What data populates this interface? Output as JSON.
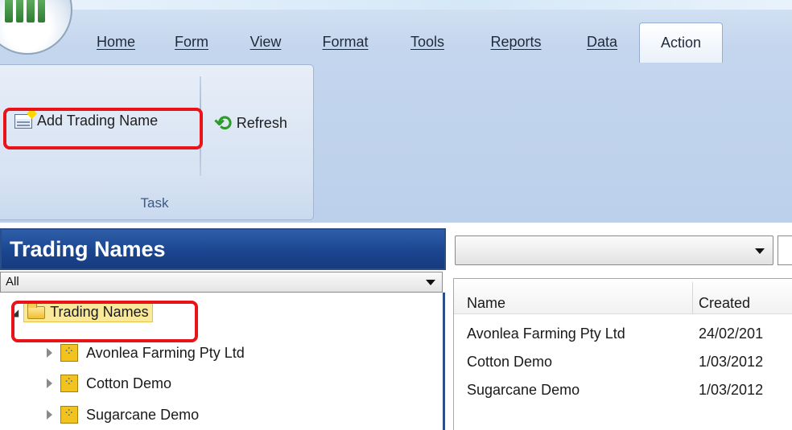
{
  "ribbon": {
    "tabs": [
      {
        "label": "Home",
        "active": false
      },
      {
        "label": "Form",
        "active": false
      },
      {
        "label": "View",
        "active": false
      },
      {
        "label": "Format",
        "active": false
      },
      {
        "label": "Tools",
        "active": false
      },
      {
        "label": "Reports",
        "active": false
      },
      {
        "label": "Data",
        "active": false
      },
      {
        "label": "Action",
        "active": true
      }
    ],
    "group_label": "Task",
    "add_trading_name_label": "Add Trading Name",
    "refresh_label": "Refresh",
    "highlight_color": "#e8141a"
  },
  "left_pane": {
    "title": "Trading Names",
    "filter_value": "All",
    "tree": {
      "root_label": "Trading Names",
      "items": [
        {
          "label": "Avonlea Farming Pty Ltd"
        },
        {
          "label": "Cotton Demo"
        },
        {
          "label": "Sugarcane Demo"
        }
      ]
    },
    "header_color": "#1b4590"
  },
  "right_pane": {
    "combo_value": "",
    "columns": {
      "name": "Name",
      "created": "Created"
    },
    "rows": [
      {
        "name": "Avonlea Farming Pty Ltd",
        "created": "24/02/201"
      },
      {
        "name": "Cotton Demo",
        "created": "1/03/2012"
      },
      {
        "name": "Sugarcane Demo",
        "created": "1/03/2012"
      }
    ]
  },
  "icons": [
    "app-orb-icon",
    "add-trading-name-icon",
    "refresh-icon",
    "folder-icon",
    "farm-icon",
    "dropdown-arrow-icon",
    "tree-expander-icon"
  ]
}
